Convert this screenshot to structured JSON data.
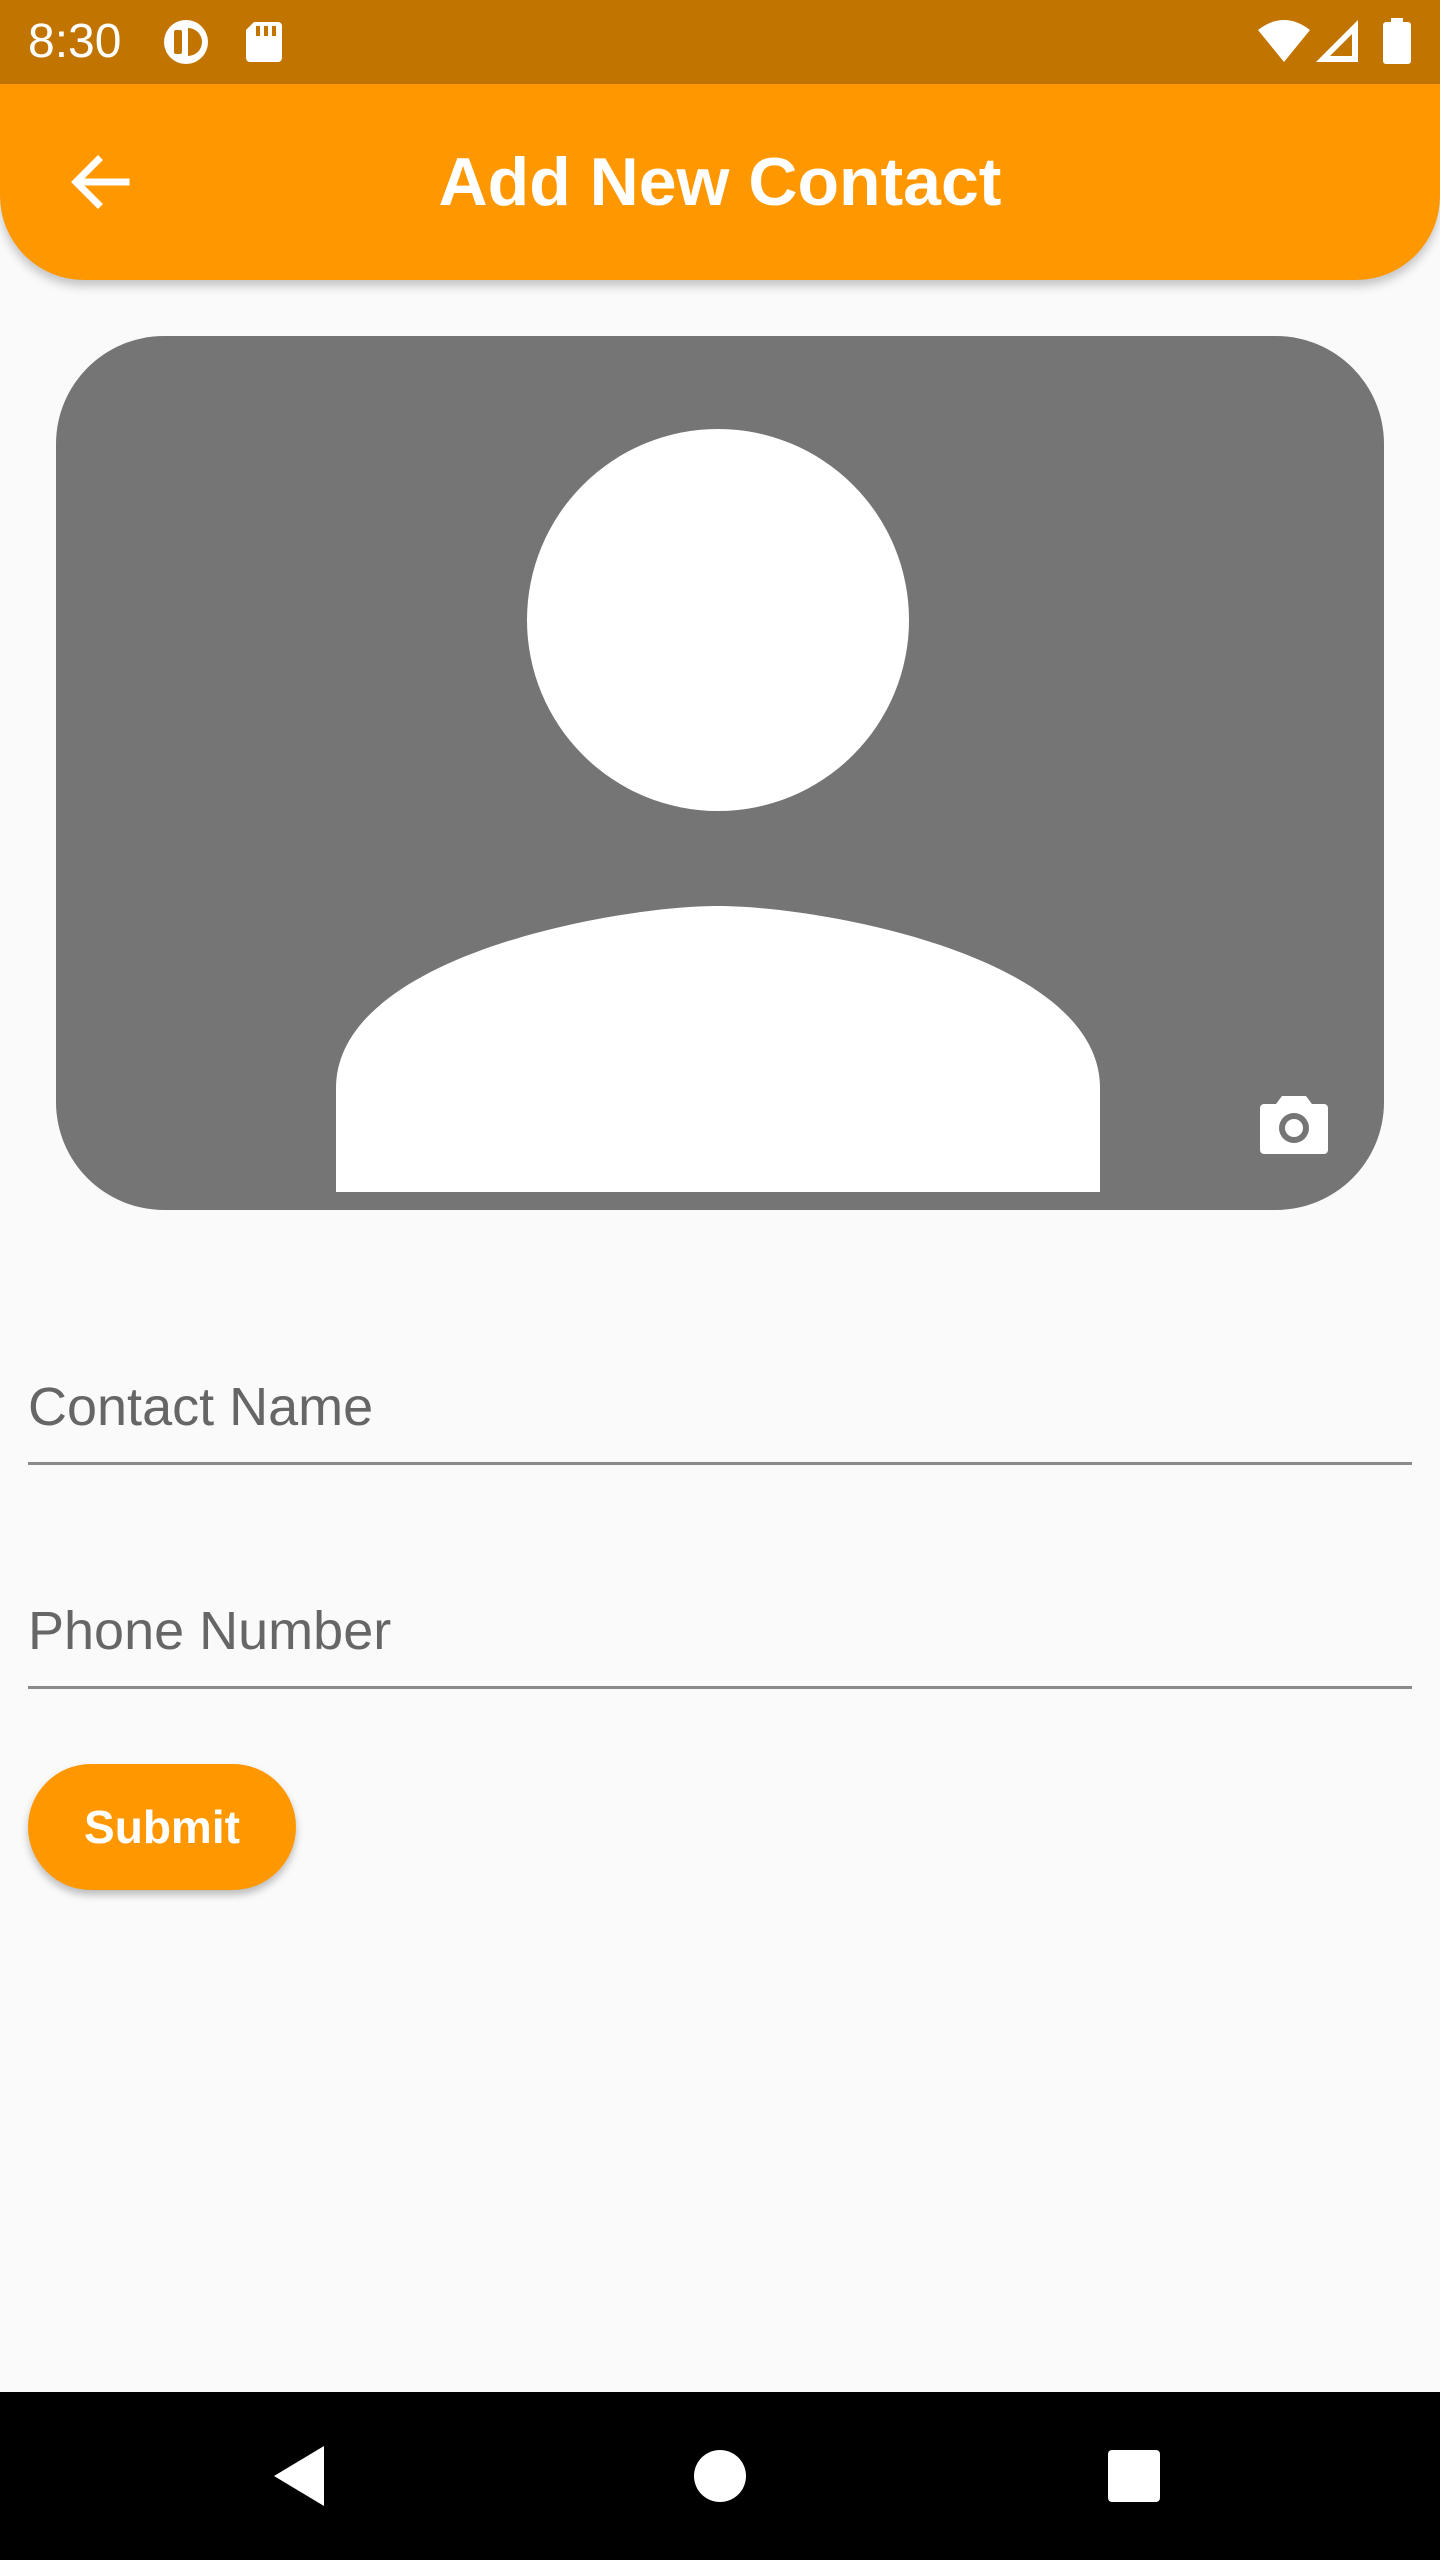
{
  "status_bar": {
    "time": "8:30",
    "icons": [
      "notification-icon",
      "sd-card-icon",
      "wifi-icon",
      "cellular-signal-icon",
      "battery-icon"
    ]
  },
  "app_bar": {
    "title": "Add New Contact",
    "back_icon": "arrow-back-icon"
  },
  "avatar": {
    "placeholder_icon": "person-silhouette-icon",
    "camera_icon": "camera-icon"
  },
  "form": {
    "contact_name_placeholder": "Contact Name",
    "contact_name_value": "",
    "phone_number_placeholder": "Phone Number",
    "phone_number_value": "",
    "submit_label": "Submit"
  },
  "nav_bar": {
    "icons": [
      "nav-back-icon",
      "nav-home-icon",
      "nav-recents-icon"
    ]
  },
  "colors": {
    "status_bar": "#c17400",
    "accent": "#ff9800",
    "avatar_background": "#757575",
    "page_background": "#fafafa"
  }
}
